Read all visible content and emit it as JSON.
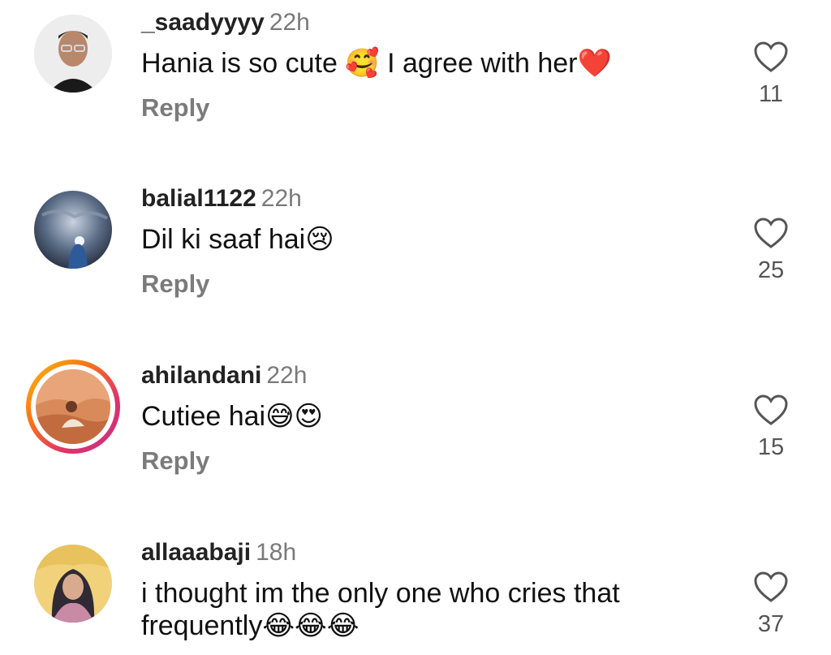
{
  "comments": [
    {
      "username": "_saadyyyy",
      "time": "22h",
      "text": "Hania is so cute 🥰 I agree with her❤️",
      "reply_label": "Reply",
      "likes": "11",
      "avatar_icon": "user-photo-icon"
    },
    {
      "username": "balial1122",
      "time": "22h",
      "text": "Dil ki saaf hai😢",
      "reply_label": "Reply",
      "likes": "25",
      "avatar_icon": "user-photo-icon"
    },
    {
      "username": "ahilandani",
      "time": "22h",
      "text": "Cutiee hai😅😍",
      "reply_label": "Reply",
      "likes": "15",
      "avatar_icon": "user-photo-icon"
    },
    {
      "username": "allaaabaji",
      "time": "18h",
      "text": "i thought im the only one who cries that frequently😂😂😂",
      "reply_label": "Reply",
      "likes": "37",
      "avatar_icon": "user-photo-icon"
    }
  ],
  "colors": {
    "username": "#222222",
    "timestamp": "#7a7a7a",
    "reply": "#7b7b7b",
    "story_ring": [
      "#f9c20b",
      "#f97316",
      "#e1306c",
      "#c13584"
    ]
  },
  "icons": {
    "like": "heart-outline-icon"
  }
}
